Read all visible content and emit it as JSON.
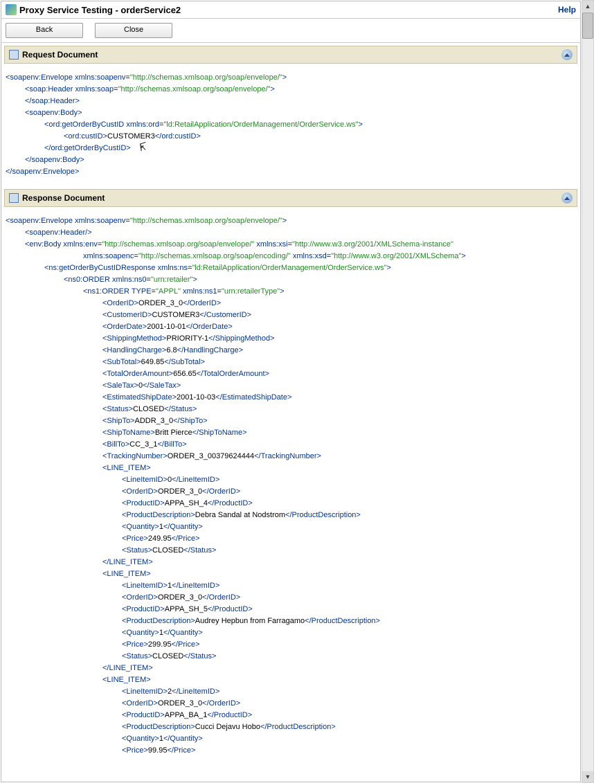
{
  "title": "Proxy Service Testing - orderService2",
  "help": "Help",
  "buttons": {
    "back": "Back",
    "close": "Close"
  },
  "panels": {
    "request": "Request Document",
    "response": "Response Document"
  },
  "request": {
    "envelope_open": "soapenv:Envelope",
    "env_attr_n": "xmlns:soapenv",
    "env_attr_v": "http://schemas.xmlsoap.org/soap/envelope/",
    "header_open": "soap:Header",
    "header_attr_n": "xmlns:soap",
    "header_attr_v": "http://schemas.xmlsoap.org/soap/envelope/",
    "header_close": "soap:Header",
    "body_open": "soapenv:Body",
    "op_open": "ord:getOrderByCustID",
    "op_attr_n": "xmlns:ord",
    "op_attr_v": "ld:RetailApplication/OrderManagement/OrderService.ws",
    "cust_open": "ord:custID",
    "cust_val": "CUSTOMER3",
    "cust_close": "ord:custID",
    "op_close": "ord:getOrderByCustID",
    "body_close": "soapenv:Body",
    "envelope_close": "soapenv:Envelope"
  },
  "response": {
    "envelope_open": "soapenv:Envelope",
    "env_attr_n": "xmlns:soapenv",
    "env_attr_v": "http://schemas.xmlsoap.org/soap/envelope/",
    "header": "soapenv:Header",
    "body_open": "env:Body",
    "body_a1n": "xmlns:env",
    "body_a1v": "http://schemas.xmlsoap.org/soap/envelope/",
    "body_a2n": "xmlns:xsi",
    "body_a2v": "http://www.w3.org/2001/XMLSchema-instance",
    "body_a3n": "xmlns:soapenc",
    "body_a3v": "http://schemas.xmlsoap.org/soap/encoding/",
    "body_a4n": "xmlns:xsd",
    "body_a4v": "http://www.w3.org/2001/XMLSchema",
    "resp_open": "ns:getOrderByCustIDResponse",
    "resp_an": "xmlns:ns",
    "resp_av": "ld:RetailApplication/OrderManagement/OrderService.ws",
    "ord0_open": "ns0:ORDER",
    "ord0_an": "xmlns:ns0",
    "ord0_av": "urn:retailer",
    "ord1_open": "ns1:ORDER",
    "ord1_a1n": "TYPE",
    "ord1_a1v": "APPL",
    "ord1_a2n": "xmlns:ns1",
    "ord1_a2v": "urn:retailerType",
    "fields": [
      {
        "name": "OrderID",
        "val": "ORDER_3_0"
      },
      {
        "name": "CustomerID",
        "val": "CUSTOMER3"
      },
      {
        "name": "OrderDate",
        "val": "2001-10-01"
      },
      {
        "name": "ShippingMethod",
        "val": "PRIORITY-1"
      },
      {
        "name": "HandlingCharge",
        "val": "6.8"
      },
      {
        "name": "SubTotal",
        "val": "649.85"
      },
      {
        "name": "TotalOrderAmount",
        "val": "656.65"
      },
      {
        "name": "SaleTax",
        "val": "0"
      },
      {
        "name": "EstimatedShipDate",
        "val": "2001-10-03"
      },
      {
        "name": "Status",
        "val": "CLOSED"
      },
      {
        "name": "ShipTo",
        "val": "ADDR_3_0"
      },
      {
        "name": "ShipToName",
        "val": "Britt Pierce"
      },
      {
        "name": "BillTo",
        "val": "CC_3_1"
      },
      {
        "name": "TrackingNumber",
        "val": "ORDER_3_00379624444"
      }
    ],
    "line_item_tag": "LINE_ITEM",
    "items": [
      {
        "LineItemID": "0",
        "OrderID": "ORDER_3_0",
        "ProductID": "APPA_SH_4",
        "ProductDescription": "Debra Sandal at Nodstrom",
        "Quantity": "1",
        "Price": "249.95",
        "Status": "CLOSED"
      },
      {
        "LineItemID": "1",
        "OrderID": "ORDER_3_0",
        "ProductID": "APPA_SH_5",
        "ProductDescription": "Audrey Hepbun from Farragamo",
        "Quantity": "1",
        "Price": "299.95",
        "Status": "CLOSED"
      },
      {
        "LineItemID": "2",
        "OrderID": "ORDER_3_0",
        "ProductID": "APPA_BA_1",
        "ProductDescription": "Cucci Dejavu Hobo",
        "Quantity": "1",
        "Price": "99.95"
      }
    ],
    "li_labels": [
      "LineItemID",
      "OrderID",
      "ProductID",
      "ProductDescription",
      "Quantity",
      "Price",
      "Status"
    ]
  }
}
